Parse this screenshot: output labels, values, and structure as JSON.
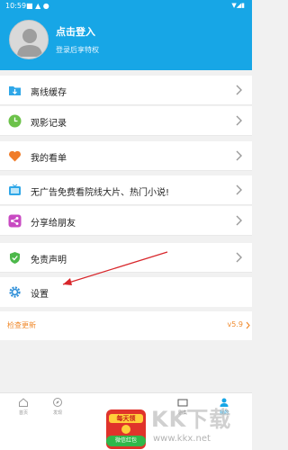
{
  "status_bar": {
    "time": "10:59",
    "icons_text": "■ ▲ ●"
  },
  "header": {
    "login_title": "点击登入",
    "login_subtitle": "登录后享特权"
  },
  "menu": [
    {
      "label": "离线缓存",
      "icon": "download-folder-icon",
      "color": "#2fa7e8"
    },
    {
      "label": "观影记录",
      "icon": "clock-icon",
      "color": "#6cc24a"
    },
    {
      "label": "我的看单",
      "icon": "heart-icon",
      "color": "#f07c2a"
    },
    {
      "label": "无广告免费看院线大片、热门小说!",
      "icon": "tv-icon",
      "color": "#2fa7e8"
    },
    {
      "label": "分享给朋友",
      "icon": "share-icon",
      "color": "#c84ac2"
    },
    {
      "label": "免责声明",
      "icon": "shield-icon",
      "color": "#4cb84a"
    },
    {
      "label": "设置",
      "icon": "gear-icon",
      "color": "#2f8fd8"
    }
  ],
  "update": {
    "label": "检查更新",
    "version": "v5.9"
  },
  "tabs": [
    {
      "label": "首页",
      "icon": "home-icon"
    },
    {
      "label": "发现",
      "icon": "compass-icon"
    },
    {
      "label": "剧集",
      "icon": "tv-tab-icon"
    },
    {
      "label": "我的",
      "icon": "user-tab-icon"
    }
  ],
  "promo": {
    "top_text": "每天领",
    "bottom_text": "微信红包"
  },
  "watermark": {
    "text": "KK下载",
    "url": "www.kkx.net"
  },
  "colors": {
    "primary": "#17a6e6",
    "accent": "#f08a2c",
    "arrow": "#d8262b"
  }
}
